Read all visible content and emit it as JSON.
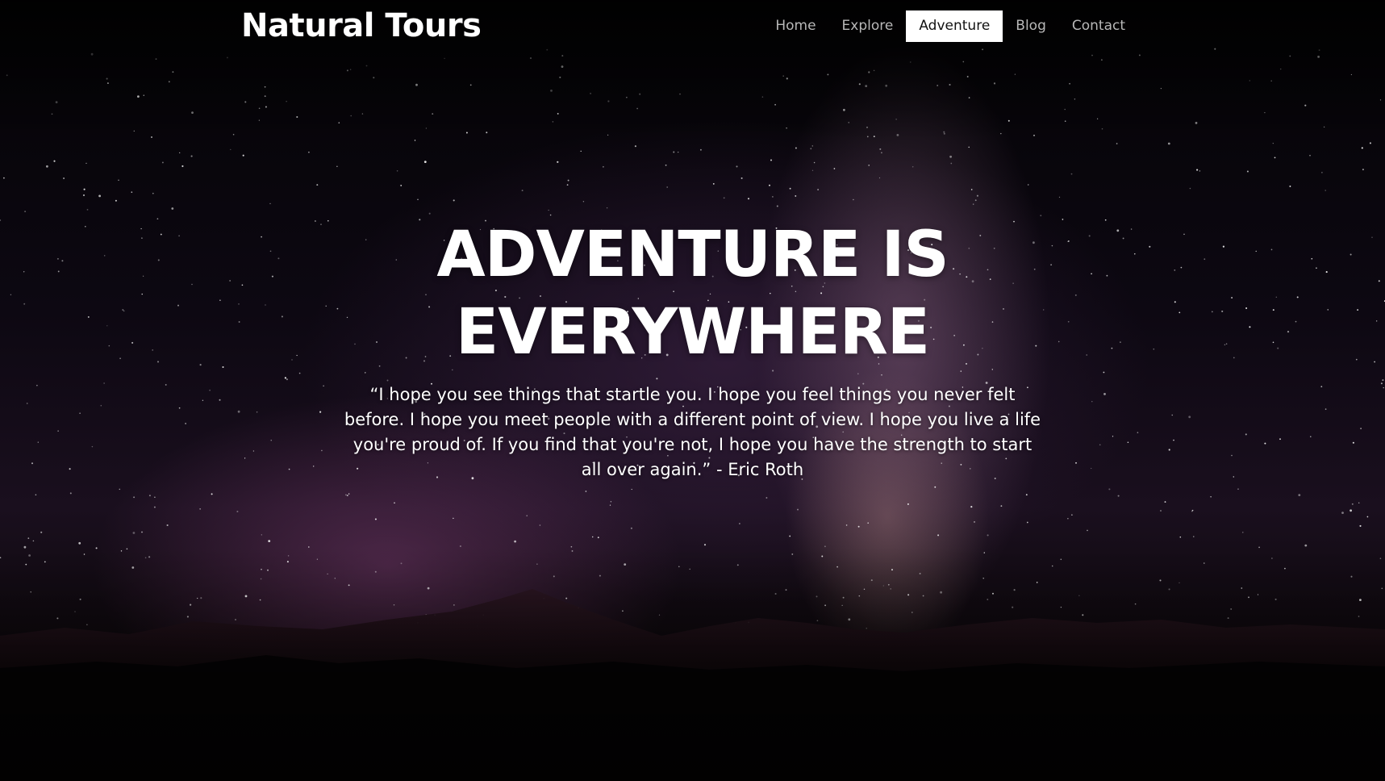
{
  "header": {
    "brand": "Natural Tours",
    "nav": [
      {
        "label": "Home",
        "active": false
      },
      {
        "label": "Explore",
        "active": false
      },
      {
        "label": "Adventure",
        "active": true
      },
      {
        "label": "Blog",
        "active": false
      },
      {
        "label": "Contact",
        "active": false
      }
    ]
  },
  "hero": {
    "title_line1": "ADVENTURE IS",
    "title_line2": "EVERYWHERE",
    "quote": "“I hope you see things that startle you. I hope you feel things you never felt before. I hope you meet people with a different point of view. I hope you live a life you're proud of. If you find that you're not, I hope you have the strength to start all over again.” - Eric Roth"
  },
  "colors": {
    "background": "#050307",
    "text": "#ffffff",
    "nav_inactive": "#b8b8b8",
    "nav_active_bg": "#ffffff",
    "nav_active_text": "#111111"
  }
}
